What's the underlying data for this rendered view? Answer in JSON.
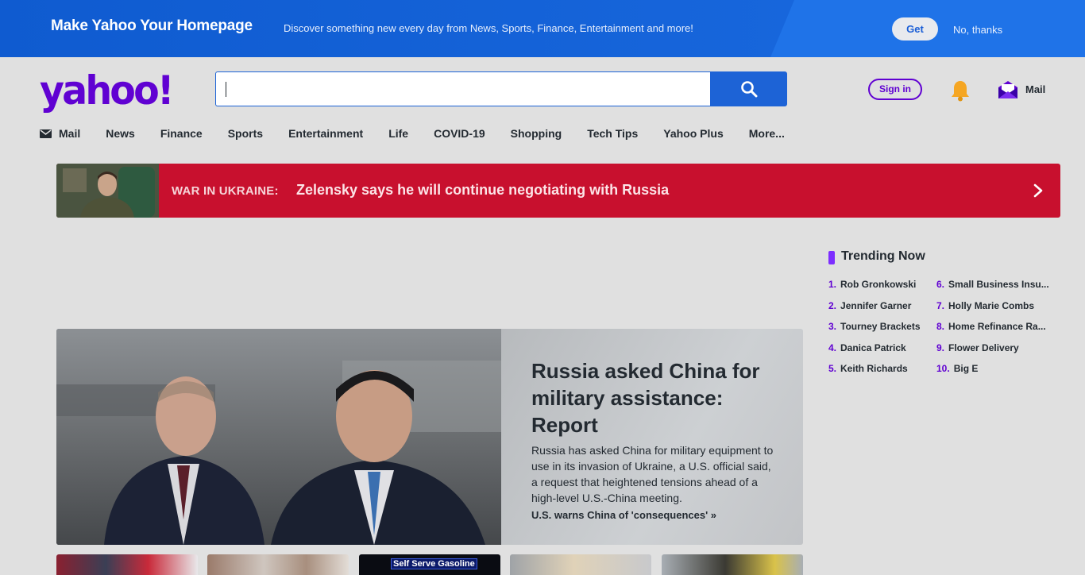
{
  "promo": {
    "title": "Make Yahoo Your Homepage",
    "subtitle": "Discover something new every day from News, Sports, Finance, Entertainment and more!",
    "get_label": "Get",
    "decline_label": "No, thanks"
  },
  "header": {
    "logo_text": "yahoo!",
    "search_value": "",
    "signin_label": "Sign in",
    "mail_label": "Mail"
  },
  "nav": {
    "items": [
      "Mail",
      "News",
      "Finance",
      "Sports",
      "Entertainment",
      "Life",
      "COVID-19",
      "Shopping",
      "Tech Tips",
      "Yahoo Plus",
      "More..."
    ]
  },
  "breaking": {
    "label": "WAR IN UKRAINE:",
    "headline": "Zelensky says he will continue negotiating with Russia"
  },
  "trending": {
    "title": "Trending Now",
    "items": [
      {
        "num": "1.",
        "label": "Rob Gronkowski"
      },
      {
        "num": "2.",
        "label": "Jennifer Garner"
      },
      {
        "num": "3.",
        "label": "Tourney Brackets"
      },
      {
        "num": "4.",
        "label": "Danica Patrick"
      },
      {
        "num": "5.",
        "label": "Keith Richards"
      },
      {
        "num": "6.",
        "label": "Small Business Insu..."
      },
      {
        "num": "7.",
        "label": "Holly Marie Combs"
      },
      {
        "num": "8.",
        "label": "Home Refinance Ra..."
      },
      {
        "num": "9.",
        "label": "Flower Delivery"
      },
      {
        "num": "10.",
        "label": "Big E"
      }
    ]
  },
  "hero": {
    "title": "Russia asked China for military assistance: Report",
    "summary": "Russia has asked China for military equipment to use in its invasion of Ukraine, a U.S. official said, a request that heightened tensions ahead of a high-level U.S.-China meeting.",
    "link": "U.S. warns China of 'consequences' »"
  },
  "thumbs": {
    "gas_label": "Self Serve Gasoline"
  },
  "colors": {
    "brand": "#6001d2",
    "search_blue": "#1d63d6",
    "breaking_red": "#c8102e",
    "promo_blue": "#0f5bd0"
  }
}
